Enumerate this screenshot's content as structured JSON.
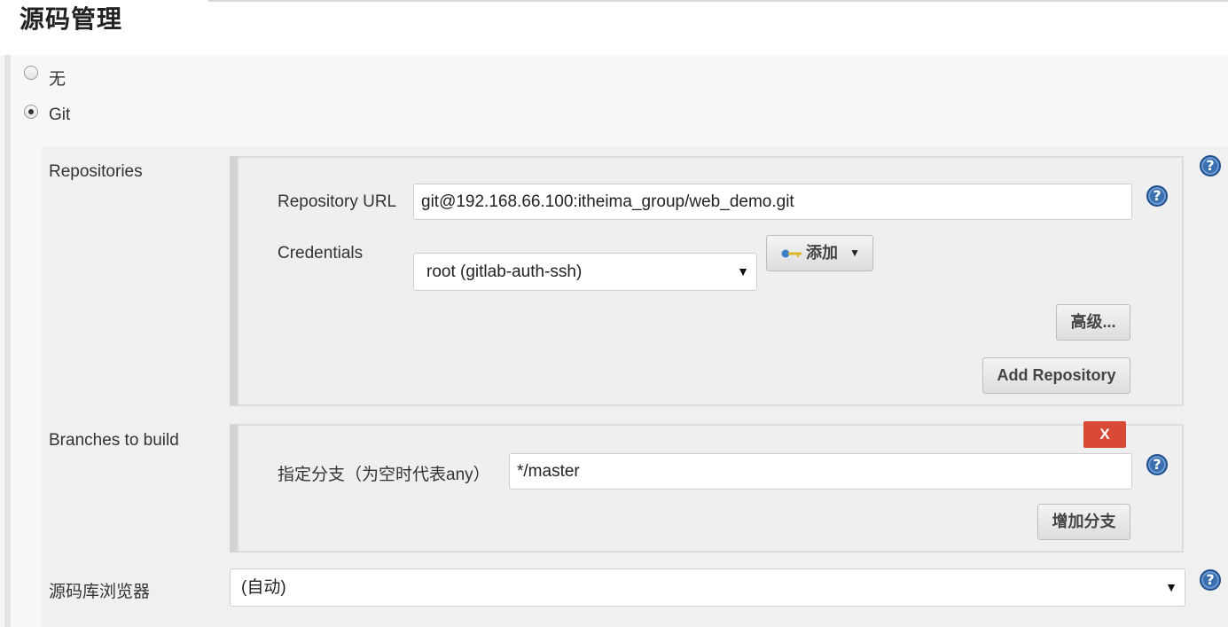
{
  "section": {
    "title": "源码管理"
  },
  "scm_options": [
    {
      "label": "无",
      "selected": false
    },
    {
      "label": "Git",
      "selected": true
    }
  ],
  "repositories": {
    "label": "Repositories",
    "url_label": "Repository URL",
    "url_value": "git@192.168.66.100:itheima_group/web_demo.git",
    "credentials_label": "Credentials",
    "credentials_value": "root (gitlab-auth-ssh)",
    "add_button": "添加",
    "advanced_button": "高级...",
    "add_repository_button": "Add Repository"
  },
  "branches": {
    "label": "Branches to build",
    "delete_button": "X",
    "spec_label": "指定分支（为空时代表any）",
    "spec_value": "*/master",
    "add_branch_button": "增加分支"
  },
  "browser": {
    "label": "源码库浏览器",
    "value": "(自动)"
  },
  "icons": {
    "help": "help-icon",
    "key": "key-icon",
    "dropdown": "chevron-down-icon",
    "radio": "radio-icon"
  },
  "colors": {
    "help_icon": "#3a6fb0",
    "delete_button": "#d84a36"
  }
}
